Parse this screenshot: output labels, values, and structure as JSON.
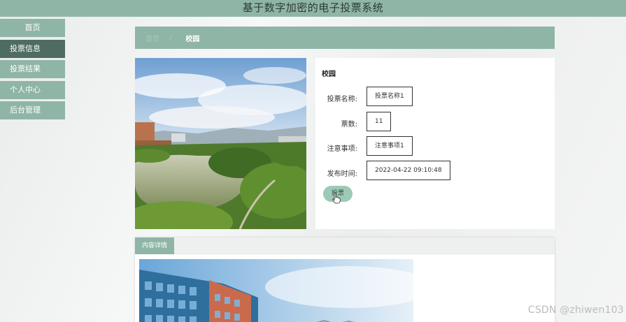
{
  "header": {
    "title": "基于数字加密的电子投票系统"
  },
  "sidebar": {
    "items": [
      {
        "label": "首页"
      },
      {
        "label": "投票信息"
      },
      {
        "label": "投票结果"
      },
      {
        "label": "个人中心"
      },
      {
        "label": "后台管理"
      }
    ],
    "active_index": 1
  },
  "breadcrumb": {
    "home": "首页",
    "current": "校园"
  },
  "detail": {
    "title": "校园",
    "fields": [
      {
        "label": "投票名称:",
        "value": "投票名称1"
      },
      {
        "label": "票数:",
        "value": "11"
      },
      {
        "label": "注意事项:",
        "value": "注意事项1"
      },
      {
        "label": "发布时间:",
        "value": "2022-04-22 09:10:48"
      }
    ],
    "vote_button": "投票"
  },
  "content_tab": {
    "label": "内容详情"
  },
  "watermark": "CSDN @zhiwen103",
  "colors": {
    "primary": "#8fb5a6",
    "sidebar_active": "#4e6c62",
    "vote_button": "#9dcab7"
  }
}
